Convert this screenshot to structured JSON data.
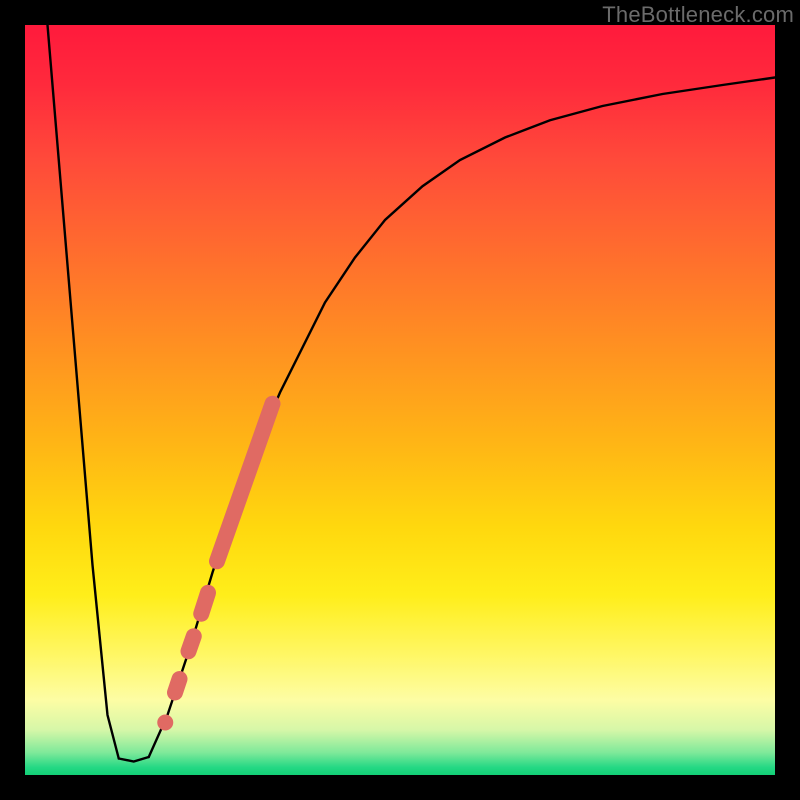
{
  "watermark": {
    "text": "TheBottleneck.com"
  },
  "chart_data": {
    "type": "line",
    "title": "",
    "xlabel": "",
    "ylabel": "",
    "x_range": [
      0,
      100
    ],
    "y_range": [
      0,
      100
    ],
    "grid": false,
    "legend": false,
    "background": "vertical-gradient red→orange→yellow→green (top→bottom)",
    "series": [
      {
        "name": "left-descent",
        "stroke": "#000000",
        "x": [
          3.0,
          5.0,
          7.0,
          9.0,
          11.0,
          12.5
        ],
        "y": [
          100,
          76,
          52,
          28,
          8,
          2.2
        ]
      },
      {
        "name": "valley-floor",
        "stroke": "#000000",
        "x": [
          12.5,
          14.5,
          16.5
        ],
        "y": [
          2.2,
          1.8,
          2.4
        ]
      },
      {
        "name": "right-ascent",
        "stroke": "#000000",
        "x": [
          16.5,
          19,
          22,
          25,
          28,
          31,
          34,
          37,
          40,
          44,
          48,
          53,
          58,
          64,
          70,
          77,
          85,
          93,
          100
        ],
        "y": [
          2.4,
          8,
          17,
          27,
          36,
          44,
          51,
          57,
          63,
          69,
          74,
          78.5,
          82,
          85,
          87.3,
          89.2,
          90.8,
          92,
          93
        ]
      }
    ],
    "overlay_markers": {
      "stroke": "#e06a63",
      "segments": [
        {
          "x": [
            20.0,
            20.6
          ],
          "y": [
            11.0,
            12.8
          ]
        },
        {
          "x": [
            21.8,
            22.5
          ],
          "y": [
            16.5,
            18.5
          ]
        },
        {
          "x": [
            23.5,
            24.4
          ],
          "y": [
            21.5,
            24.3
          ]
        },
        {
          "x": [
            25.6,
            33.0
          ],
          "y": [
            28.5,
            49.5
          ]
        }
      ],
      "dots": [
        {
          "x": 18.7,
          "y": 7.0
        }
      ]
    }
  }
}
